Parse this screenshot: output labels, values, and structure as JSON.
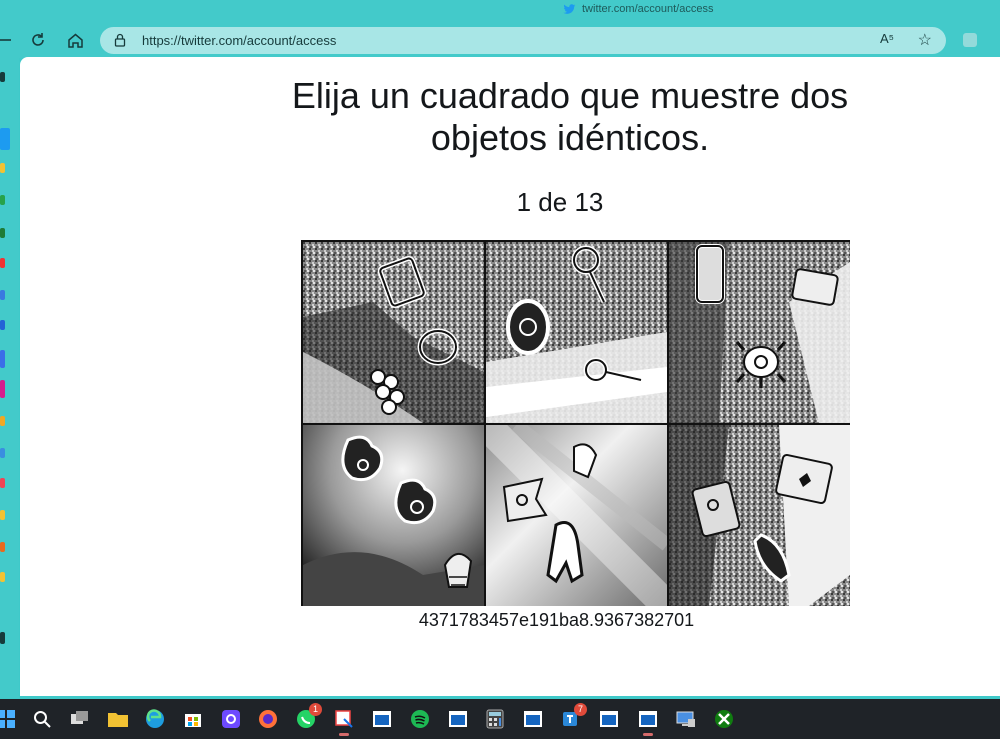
{
  "browser": {
    "tab_title": "twitter.com/account/access",
    "address": "https://twitter.com/account/access",
    "read_aloud_label": "A⁵"
  },
  "captcha": {
    "title": "Elija un cuadrado que muestre dos objetos idénticos.",
    "progress": "1 de 13",
    "id_text": "4371783457e191ba8.9367382701",
    "tiles": [
      {
        "row": 1,
        "col": 1,
        "objects": [
          "window-icon",
          "pear-icon",
          "grapes-icon"
        ]
      },
      {
        "row": 1,
        "col": 2,
        "objects": [
          "key-icon",
          "turtle-icon",
          "key-icon"
        ]
      },
      {
        "row": 1,
        "col": 3,
        "objects": [
          "phone-icon",
          "turtle-icon",
          "card-icon"
        ]
      },
      {
        "row": 2,
        "col": 1,
        "objects": [
          "pear-icon",
          "pear-icon",
          "cupcake-icon"
        ]
      },
      {
        "row": 2,
        "col": 2,
        "objects": [
          "shell-icon",
          "flag-icon",
          "squid-icon"
        ]
      },
      {
        "row": 2,
        "col": 3,
        "objects": [
          "card-icon",
          "photo-icon",
          "fish-icon"
        ]
      }
    ]
  },
  "taskbar": {
    "apps": [
      {
        "name": "windows-start-icon"
      },
      {
        "name": "search-icon"
      },
      {
        "name": "task-view-icon"
      },
      {
        "name": "file-explorer-icon"
      },
      {
        "name": "edge-icon"
      },
      {
        "name": "store-icon"
      },
      {
        "name": "proton-icon"
      },
      {
        "name": "firefox-icon"
      },
      {
        "name": "whatsapp-icon",
        "badge": "1"
      },
      {
        "name": "snipping-tool-icon"
      },
      {
        "name": "app-window-icon"
      },
      {
        "name": "spotify-icon"
      },
      {
        "name": "app-window-icon"
      },
      {
        "name": "calculator-icon"
      },
      {
        "name": "app-window-icon"
      },
      {
        "name": "teams-icon",
        "badge": "7"
      },
      {
        "name": "app-window-icon"
      },
      {
        "name": "app-window-icon"
      },
      {
        "name": "remote-desktop-icon"
      },
      {
        "name": "xbox-icon"
      }
    ]
  },
  "colors": {
    "accent": "#3fc9c9",
    "twitter_blue": "#1d9bf0",
    "taskbar": "#1f2328"
  }
}
